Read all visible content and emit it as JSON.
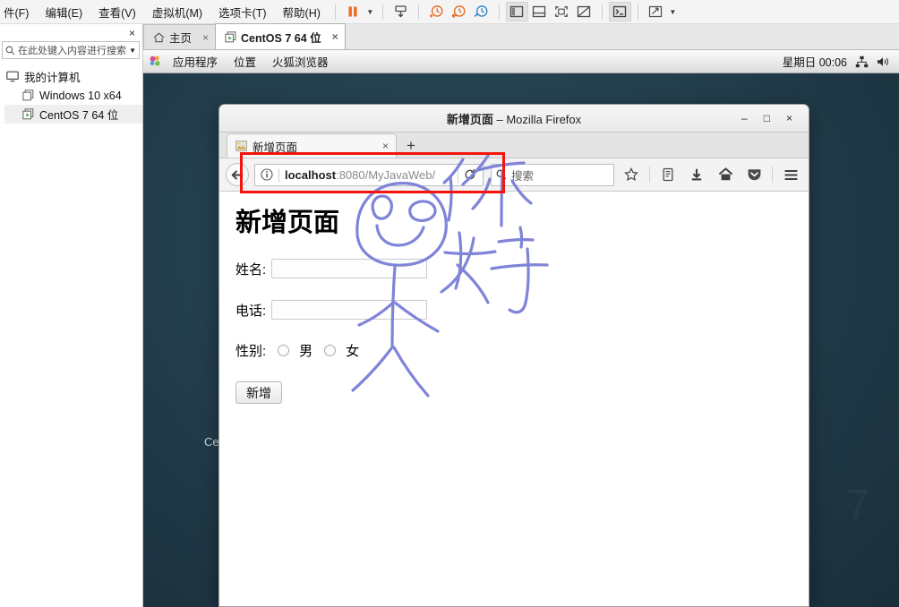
{
  "vmware": {
    "menus": [
      {
        "label": "件(F)",
        "name": "menu-file"
      },
      {
        "label": "编辑(E)",
        "name": "menu-edit"
      },
      {
        "label": "查看(V)",
        "name": "menu-view"
      },
      {
        "label": "虚拟机(M)",
        "name": "menu-vm"
      },
      {
        "label": "选项卡(T)",
        "name": "menu-tabs"
      },
      {
        "label": "帮助(H)",
        "name": "menu-help"
      }
    ],
    "sidebar": {
      "close_label": "×",
      "search_placeholder": "在此处键入内容进行搜索",
      "dropdown_arrow": "▼",
      "tree": [
        {
          "label": "我的计算机",
          "name": "tree-my-computer",
          "level": 0,
          "selected": false,
          "icon": "computer-icon"
        },
        {
          "label": "Windows 10 x64",
          "name": "tree-vm-windows10",
          "level": 1,
          "selected": false,
          "icon": "vm-icon"
        },
        {
          "label": "CentOS 7 64 位",
          "name": "tree-vm-centos7",
          "level": 1,
          "selected": true,
          "icon": "vm-running-icon"
        }
      ]
    },
    "tabs": [
      {
        "label": "主页",
        "name": "tab-home",
        "active": false,
        "icon": "home-icon"
      },
      {
        "label": "CentOS 7 64 位",
        "name": "tab-centos7",
        "active": true,
        "icon": "vm-running-icon"
      }
    ],
    "tab_close": "×"
  },
  "guest": {
    "panel": {
      "menus": [
        {
          "label": "应用程序",
          "name": "gnome-applications"
        },
        {
          "label": "位置",
          "name": "gnome-places"
        },
        {
          "label": "火狐浏览器",
          "name": "gnome-firefox"
        }
      ],
      "clock": "星期日 00:06"
    },
    "desktop_label": "Ce",
    "watermark": "7"
  },
  "firefox": {
    "window_title": "新增页面",
    "window_title_sep": "–",
    "window_title_app": "Mozilla Firefox",
    "window_buttons": {
      "minimize": "–",
      "maximize": "□",
      "close": "×"
    },
    "tab": {
      "label": "新增页面",
      "close": "×",
      "new_tab": "+"
    },
    "url": {
      "host": "localhost",
      "rest": ":8080/MyJavaWeb/"
    },
    "search_placeholder": "搜索",
    "toolbar_icons": [
      {
        "name": "bookmark-star-icon"
      },
      {
        "name": "library-icon"
      },
      {
        "name": "downloads-icon"
      },
      {
        "name": "home-icon"
      },
      {
        "name": "pocket-icon"
      },
      {
        "name": "hamburger-menu-icon"
      }
    ]
  },
  "page": {
    "heading": "新增页面",
    "fields": [
      {
        "label": "姓名:",
        "name": "name-field",
        "value": ""
      },
      {
        "label": "电话:",
        "name": "phone-field",
        "value": ""
      }
    ],
    "gender": {
      "label": "性别:",
      "options": [
        {
          "label": "男",
          "name": "gender-male-radio",
          "checked": false
        },
        {
          "label": "女",
          "name": "gender-female-radio",
          "checked": false
        }
      ]
    },
    "submit_label": "新增"
  },
  "annotations": {
    "highlight_color": "#f3140b",
    "ink_color": "#7f84d8",
    "handwriting_text": "你好"
  }
}
